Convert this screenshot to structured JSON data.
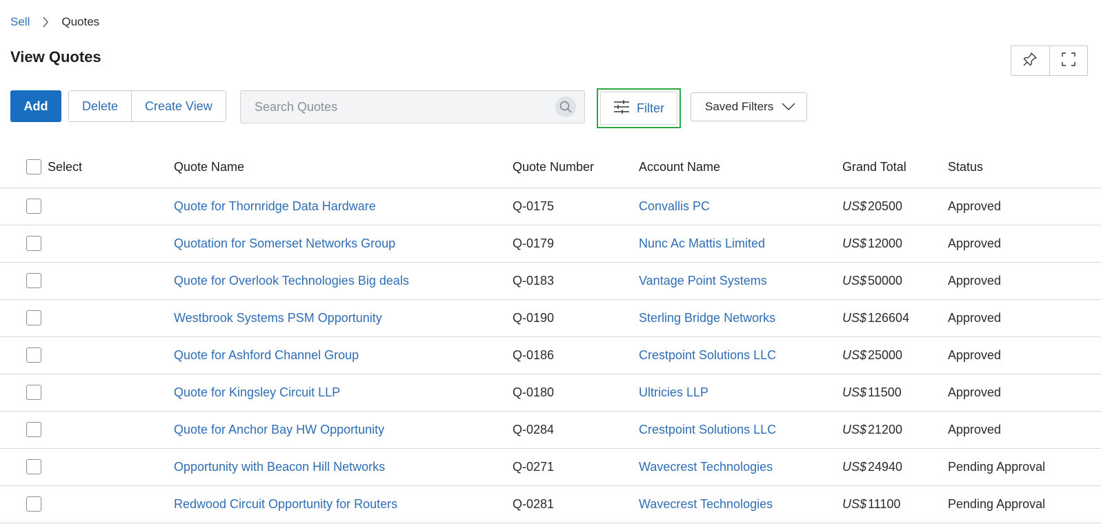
{
  "breadcrumb": {
    "parent": "Sell",
    "current": "Quotes"
  },
  "page": {
    "title": "View Quotes"
  },
  "toolbar": {
    "add_label": "Add",
    "delete_label": "Delete",
    "create_view_label": "Create View",
    "search_placeholder": "Search Quotes",
    "filter_label": "Filter",
    "saved_filters_label": "Saved Filters"
  },
  "table": {
    "headers": {
      "select": "Select",
      "quote_name": "Quote Name",
      "quote_number": "Quote Number",
      "account_name": "Account Name",
      "grand_total": "Grand Total",
      "status": "Status"
    },
    "currency": "US$",
    "rows": [
      {
        "quote_name": "Quote for Thornridge Data Hardware",
        "quote_number": "Q-0175",
        "account_name": "Convallis PC",
        "amount": "20500",
        "status": "Approved"
      },
      {
        "quote_name": "Quotation for Somerset Networks Group",
        "quote_number": "Q-0179",
        "account_name": "Nunc Ac Mattis Limited",
        "amount": "12000",
        "status": "Approved"
      },
      {
        "quote_name": "Quote for Overlook Technologies Big deals",
        "quote_number": "Q-0183",
        "account_name": "Vantage Point Systems",
        "amount": "50000",
        "status": "Approved"
      },
      {
        "quote_name": "Westbrook Systems PSM Opportunity",
        "quote_number": "Q-0190",
        "account_name": "Sterling Bridge Networks",
        "amount": "126604",
        "status": "Approved"
      },
      {
        "quote_name": "Quote for Ashford Channel Group",
        "quote_number": "Q-0186",
        "account_name": "Crestpoint Solutions LLC",
        "amount": "25000",
        "status": "Approved"
      },
      {
        "quote_name": "Quote for Kingsley Circuit LLP",
        "quote_number": "Q-0180",
        "account_name": "Ultricies LLP",
        "amount": "11500",
        "status": "Approved"
      },
      {
        "quote_name": "Quote for Anchor Bay HW Opportunity",
        "quote_number": "Q-0284",
        "account_name": "Crestpoint Solutions LLC",
        "amount": "21200",
        "status": "Approved"
      },
      {
        "quote_name": "Opportunity with Beacon Hill Networks",
        "quote_number": "Q-0271",
        "account_name": "Wavecrest Technologies",
        "amount": "24940",
        "status": "Pending Approval"
      },
      {
        "quote_name": "Redwood Circuit Opportunity for Routers",
        "quote_number": "Q-0281",
        "account_name": "Wavecrest Technologies",
        "amount": "11100",
        "status": "Pending Approval"
      }
    ]
  },
  "icons": {
    "breadcrumb_separator": "chevron-right-icon",
    "pin": "pin-icon",
    "fullscreen": "expand-icon",
    "search": "search-icon",
    "filter": "sliders-icon",
    "saved_filters": "chevron-down-icon"
  },
  "colors": {
    "primary": "#1a6ec1",
    "link": "#2f6db5",
    "focus_outline": "#2aa843",
    "border": "#c8c8c8",
    "search_bg": "#f3f4f6"
  }
}
